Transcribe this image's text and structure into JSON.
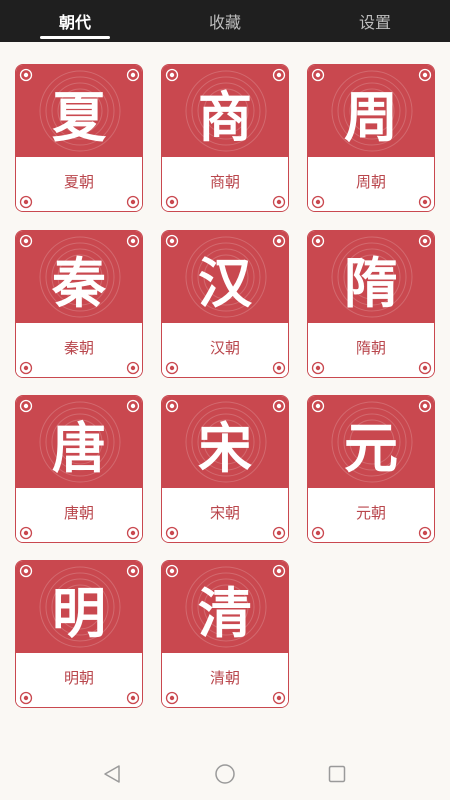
{
  "tabs": [
    {
      "label": "朝代",
      "active": true
    },
    {
      "label": "收藏",
      "active": false
    },
    {
      "label": "设置",
      "active": false
    }
  ],
  "dynasties": [
    {
      "char": "夏",
      "label": "夏朝"
    },
    {
      "char": "商",
      "label": "商朝"
    },
    {
      "char": "周",
      "label": "周朝"
    },
    {
      "char": "秦",
      "label": "秦朝"
    },
    {
      "char": "汉",
      "label": "汉朝"
    },
    {
      "char": "隋",
      "label": "隋朝"
    },
    {
      "char": "唐",
      "label": "唐朝"
    },
    {
      "char": "宋",
      "label": "宋朝"
    },
    {
      "char": "元",
      "label": "元朝"
    },
    {
      "char": "明",
      "label": "明朝"
    },
    {
      "char": "清",
      "label": "清朝"
    }
  ],
  "colors": {
    "accent": "#c9484f",
    "tabbar": "#1f1f1f",
    "background": "#faf8f4"
  },
  "navbar": {
    "back_icon": "back-triangle-icon",
    "home_icon": "home-circle-icon",
    "recent_icon": "recent-square-icon"
  }
}
